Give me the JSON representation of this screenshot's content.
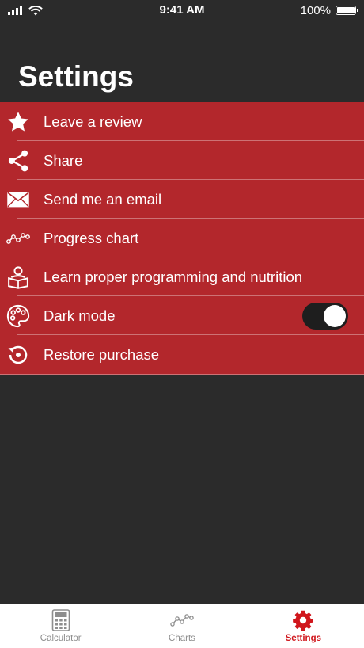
{
  "status_bar": {
    "time": "9:41 AM",
    "battery": "100%"
  },
  "header": {
    "title": "Settings"
  },
  "settings": {
    "items": [
      {
        "label": "Leave a review",
        "icon": "star-icon"
      },
      {
        "label": "Share",
        "icon": "share-icon"
      },
      {
        "label": "Send me an email",
        "icon": "envelope-icon"
      },
      {
        "label": "Progress chart",
        "icon": "chart-line-icon"
      },
      {
        "label": "Learn proper programming and nutrition",
        "icon": "reader-icon"
      },
      {
        "label": "Dark mode",
        "icon": "palette-icon",
        "toggle": true
      },
      {
        "label": "Restore purchase",
        "icon": "restore-icon"
      }
    ]
  },
  "tabs": [
    {
      "label": "Calculator",
      "icon": "calculator-icon"
    },
    {
      "label": "Charts",
      "icon": "chart-line-icon"
    },
    {
      "label": "Settings",
      "icon": "gear-icon",
      "active": true
    }
  ],
  "colors": {
    "accent": "#d0161c",
    "list_bg": "#b3272c",
    "background": "#2b2b2b"
  }
}
